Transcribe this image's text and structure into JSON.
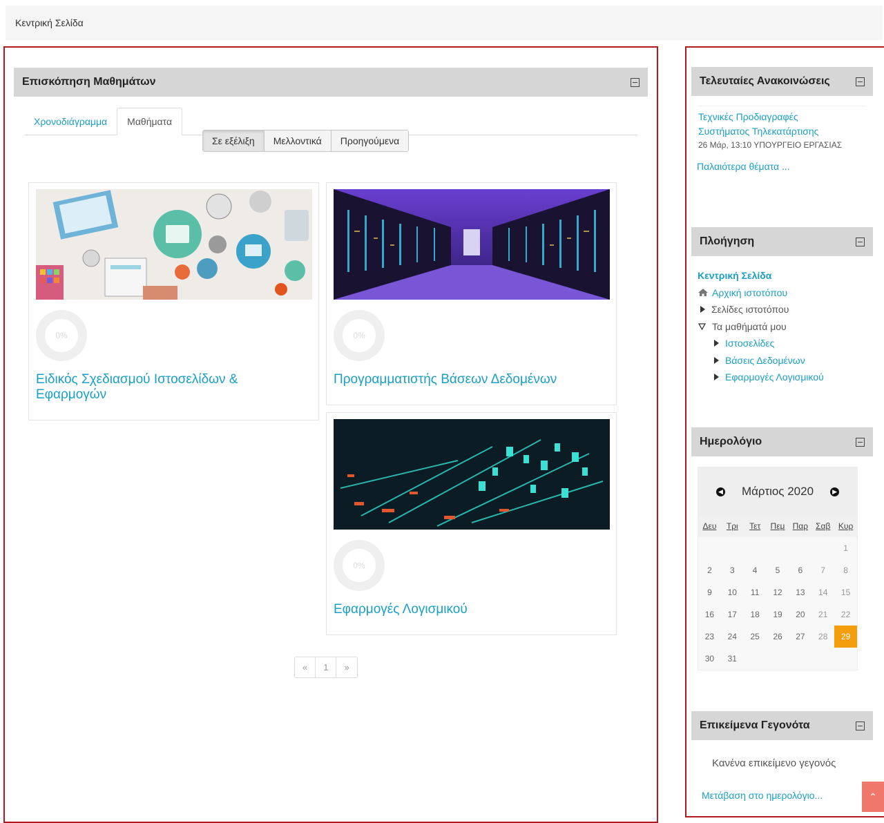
{
  "breadcrumb": {
    "home": "Κεντρική Σελίδα"
  },
  "course_overview": {
    "title": "Επισκόπηση Μαθημάτων",
    "tabs": [
      "Χρονοδιάγραμμα",
      "Μαθήματα"
    ],
    "filters": [
      "Σε εξέλιξη",
      "Μελλοντικά",
      "Προηγούμενα"
    ],
    "courses": [
      {
        "name": "Ειδικός Σχεδιασμού Ιστοσελίδων & Εφαρμογών",
        "progress": "0%"
      },
      {
        "name": "Προγραμματιστής Βάσεων Δεδομένων",
        "progress": "0%"
      },
      {
        "name": "Εφαρμογές Λογισμικού",
        "progress": "0%"
      }
    ],
    "pagination": {
      "prev": "«",
      "page": "1",
      "next": "»"
    }
  },
  "announcements": {
    "title": "Τελευταίες Ανακοινώσεις",
    "item_title": "Τεχνικές Προδιαγραφές Συστήματος Τηλεκατάρτισης",
    "item_meta": "26 Μάρ, 13:10  ΥΠΟΥΡΓΕΙΟ ΕΡΓΑΣΙΑΣ",
    "older": "Παλαιότερα θέματα ..."
  },
  "navigation": {
    "title": "Πλοήγηση",
    "home": "Κεντρική Σελίδα",
    "site_home": "Αρχική ιστοτόπου",
    "site_pages": "Σελίδες ιστοτόπου",
    "my_courses": "Τα μαθήματά μου",
    "courses": [
      "Ιστοσελίδες",
      "Βάσεις Δεδομένων",
      "Εφαρμογές Λογισμικού"
    ]
  },
  "calendar": {
    "title": "Ημερολόγιο",
    "month": "Μάρτιος 2020",
    "prev_icon": "arrow-left-circle-icon",
    "next_icon": "arrow-right-circle-icon",
    "weekdays": [
      "Δευ",
      "Τρι",
      "Τετ",
      "Πεμ",
      "Παρ",
      "Σαβ",
      "Κυρ"
    ],
    "weeks": [
      [
        "",
        "",
        "",
        "",
        "",
        "",
        "1"
      ],
      [
        "2",
        "3",
        "4",
        "5",
        "6",
        "7",
        "8"
      ],
      [
        "9",
        "10",
        "11",
        "12",
        "13",
        "14",
        "15"
      ],
      [
        "16",
        "17",
        "18",
        "19",
        "20",
        "21",
        "22"
      ],
      [
        "23",
        "24",
        "25",
        "26",
        "27",
        "28",
        "29"
      ],
      [
        "30",
        "31",
        "",
        "",
        "",
        "",
        ""
      ]
    ],
    "today": "29",
    "today_color": "#f49d0d"
  },
  "upcoming": {
    "title": "Επικείμενα Γεγονότα",
    "empty": "Κανένα επικείμενο γεγονός",
    "goto": "Μετάβαση στο ημερολόγιο..."
  },
  "colors": {
    "accent": "#1a9fc4",
    "frame": "#b0191e"
  }
}
